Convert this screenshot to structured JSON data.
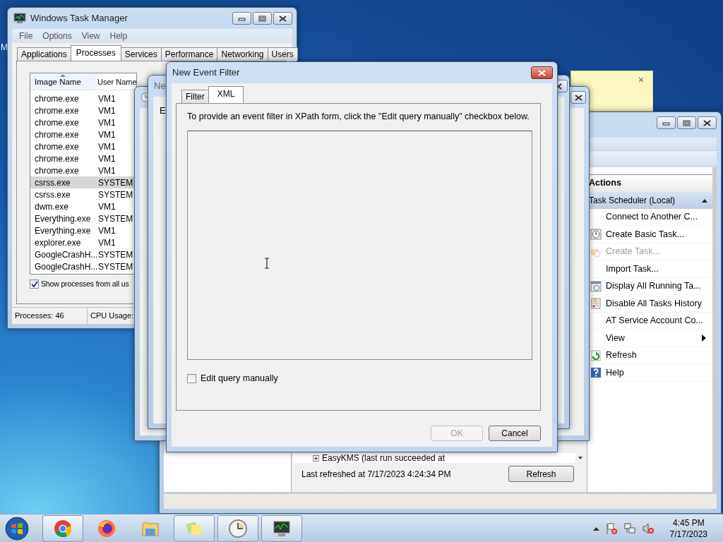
{
  "desktop_label": "M",
  "sticky_note": {
    "close": "×"
  },
  "task_scheduler": {
    "actions_title": "Actions",
    "section": {
      "label": "Task Scheduler (Local)",
      "expanded": true
    },
    "actions": [
      {
        "label": "Connect to Another C...",
        "kind": "plain",
        "disabled": false
      },
      {
        "label": "Create Basic Task...",
        "kind": "clock",
        "disabled": false
      },
      {
        "label": "Create Task...",
        "kind": "task",
        "disabled": true
      },
      {
        "label": "Import Task...",
        "kind": "plain",
        "disabled": false
      },
      {
        "label": "Display All Running Ta...",
        "kind": "running",
        "disabled": false
      },
      {
        "label": "Disable All Tasks History",
        "kind": "history",
        "disabled": false
      },
      {
        "label": "AT Service Account Co...",
        "kind": "plain",
        "disabled": false
      },
      {
        "label": "View",
        "kind": "submenu",
        "disabled": false
      },
      {
        "label": "Refresh",
        "kind": "refresh",
        "disabled": false
      },
      {
        "label": "Help",
        "kind": "help",
        "disabled": false
      }
    ],
    "tree_item": "EasyKMS (last run succeeded at",
    "status": "Last refreshed at 7/17/2023 4:24:34 PM",
    "refresh_button": "Refresh"
  },
  "task_manager": {
    "title": "Windows Task Manager",
    "menu": [
      "File",
      "Options",
      "View",
      "Help"
    ],
    "tabs": [
      {
        "label": "Applications",
        "selected": false
      },
      {
        "label": "Processes",
        "selected": true
      },
      {
        "label": "Services",
        "selected": false
      },
      {
        "label": "Performance",
        "selected": false
      },
      {
        "label": "Networking",
        "selected": false
      },
      {
        "label": "Users",
        "selected": false
      }
    ],
    "columns": [
      "Image Name",
      "User Name"
    ],
    "rows": [
      {
        "image": "chrome.exe",
        "user": "VM1",
        "selected": false
      },
      {
        "image": "chrome.exe",
        "user": "VM1",
        "selected": false
      },
      {
        "image": "chrome.exe",
        "user": "VM1",
        "selected": false
      },
      {
        "image": "chrome.exe",
        "user": "VM1",
        "selected": false
      },
      {
        "image": "chrome.exe",
        "user": "VM1",
        "selected": false
      },
      {
        "image": "chrome.exe",
        "user": "VM1",
        "selected": false
      },
      {
        "image": "chrome.exe",
        "user": "VM1",
        "selected": false
      },
      {
        "image": "csrss.exe",
        "user": "SYSTEM",
        "selected": true
      },
      {
        "image": "csrss.exe",
        "user": "SYSTEM",
        "selected": false
      },
      {
        "image": "dwm.exe",
        "user": "VM1",
        "selected": false
      },
      {
        "image": "Everything.exe",
        "user": "SYSTEM",
        "selected": false
      },
      {
        "image": "Everything.exe",
        "user": "VM1",
        "selected": false
      },
      {
        "image": "explorer.exe",
        "user": "VM1",
        "selected": false
      },
      {
        "image": "GoogleCrashH...",
        "user": "SYSTEM",
        "selected": false
      },
      {
        "image": "GoogleCrashH...",
        "user": "SYSTEM",
        "selected": false
      }
    ],
    "show_all": {
      "label": "Show processes from all us",
      "checked": true
    },
    "status": [
      "Processes: 46",
      "CPU Usage:"
    ]
  },
  "back_window_1": {
    "title": "Ne"
  },
  "back_window_2": {
    "label": "E"
  },
  "dialog": {
    "title": "New Event Filter",
    "tabs": [
      {
        "label": "Filter",
        "selected": false
      },
      {
        "label": "XML",
        "selected": true
      }
    ],
    "instruction": "To provide an event filter in XPath form, click the \"Edit query manually\" checkbox below.",
    "edit_manually": {
      "label": "Edit query manually",
      "checked": false
    },
    "buttons": [
      {
        "label": "OK",
        "disabled": true
      },
      {
        "label": "Cancel",
        "disabled": false
      }
    ]
  },
  "taskbar": {
    "items": [
      {
        "kind": "chrome",
        "running": true
      },
      {
        "kind": "firefox",
        "running": false
      },
      {
        "kind": "explorer",
        "running": false
      },
      {
        "kind": "notes",
        "running": true
      },
      {
        "kind": "clock",
        "running": true
      },
      {
        "kind": "monitor",
        "running": true
      }
    ],
    "time": "4:45 PM",
    "date": "7/17/2023"
  }
}
